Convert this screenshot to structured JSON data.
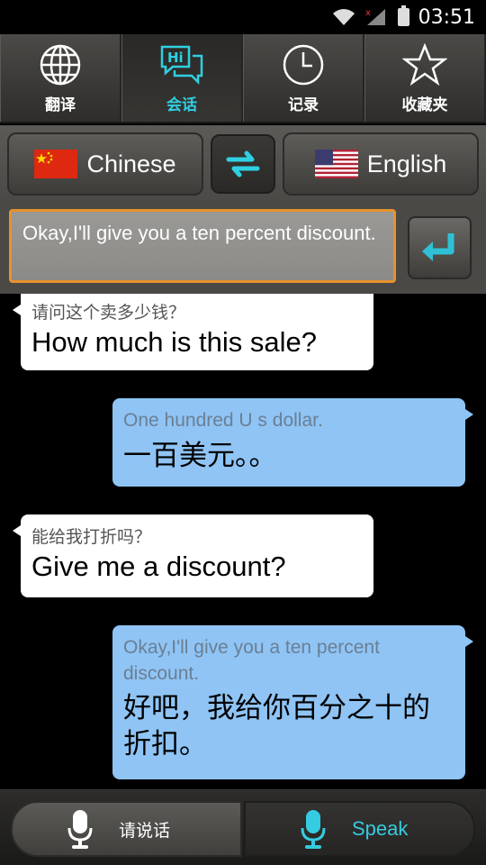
{
  "status_bar": {
    "time": "03:51",
    "icons": [
      "wifi-icon",
      "signal-icon",
      "battery-icon"
    ]
  },
  "tabs": [
    {
      "label": "翻译",
      "icon": "globe-icon",
      "active": false
    },
    {
      "label": "会话",
      "icon": "chat-hi-icon",
      "icon_text": "Hi",
      "active": true
    },
    {
      "label": "记录",
      "icon": "clock-icon",
      "active": false
    },
    {
      "label": "收藏夹",
      "icon": "star-icon",
      "active": false
    }
  ],
  "languages": {
    "source": "Chinese",
    "target": "English",
    "source_flag": "china-flag",
    "target_flag": "usa-flag"
  },
  "input": {
    "value": "Okay,I'll give you a ten percent discount."
  },
  "conversation": [
    {
      "side": "left",
      "source": "请问这个卖多少钱？",
      "translation": "How much is this sale?"
    },
    {
      "side": "right",
      "source": "One hundred U s dollar.",
      "translation": "一百美元。。"
    },
    {
      "side": "left",
      "source": "能给我打折吗？",
      "translation": "Give me a discount?"
    },
    {
      "side": "right",
      "source": "Okay,I'll give you a ten percent discount.",
      "translation": "好吧，我给你百分之十的折扣。"
    }
  ],
  "bottom": {
    "chinese_label": "请说话",
    "english_label": "Speak"
  },
  "colors": {
    "accent": "#2fd0e2",
    "input_border": "#e8922c",
    "bubble_right": "#8fc4f5"
  }
}
